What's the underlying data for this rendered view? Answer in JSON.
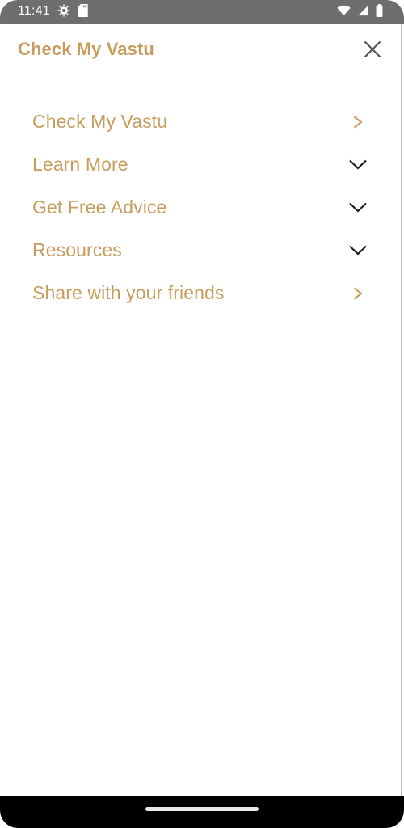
{
  "status_bar": {
    "time": "11:41",
    "left_icons": [
      {
        "name": "settings-gear-icon",
        "glyph": "gear"
      },
      {
        "name": "sd-card-icon",
        "glyph": "sd-card"
      }
    ],
    "right_icons": [
      {
        "name": "wifi-icon",
        "glyph": "wifi"
      },
      {
        "name": "cellular-signal-icon",
        "glyph": "signal"
      },
      {
        "name": "battery-icon",
        "glyph": "battery"
      }
    ],
    "background_color": "#6e6e6e",
    "foreground_color": "#ffffff"
  },
  "header": {
    "title": "Check My Vastu",
    "title_color": "#c79c5c",
    "close_icon": "close-icon",
    "close_icon_color": "#555555"
  },
  "menu": {
    "accent_color": "#c79c5c",
    "chevron_color": "#1a1a1a",
    "items": [
      {
        "label": "Check My Vastu",
        "trailing": "arrow-right-icon",
        "trailing_glyph": ">",
        "expandable": false
      },
      {
        "label": "Learn More",
        "trailing": "chevron-down-icon",
        "trailing_glyph": "v",
        "expandable": true
      },
      {
        "label": "Get Free Advice",
        "trailing": "chevron-down-icon",
        "trailing_glyph": "v",
        "expandable": true
      },
      {
        "label": "Resources",
        "trailing": "chevron-down-icon",
        "trailing_glyph": "v",
        "expandable": true
      },
      {
        "label": "Share with your friends",
        "trailing": "arrow-right-icon",
        "trailing_glyph": ">",
        "expandable": false
      }
    ]
  },
  "navigation_bar": {
    "gesture_pill": "home-gesture-pill",
    "background_color": "#000000"
  }
}
